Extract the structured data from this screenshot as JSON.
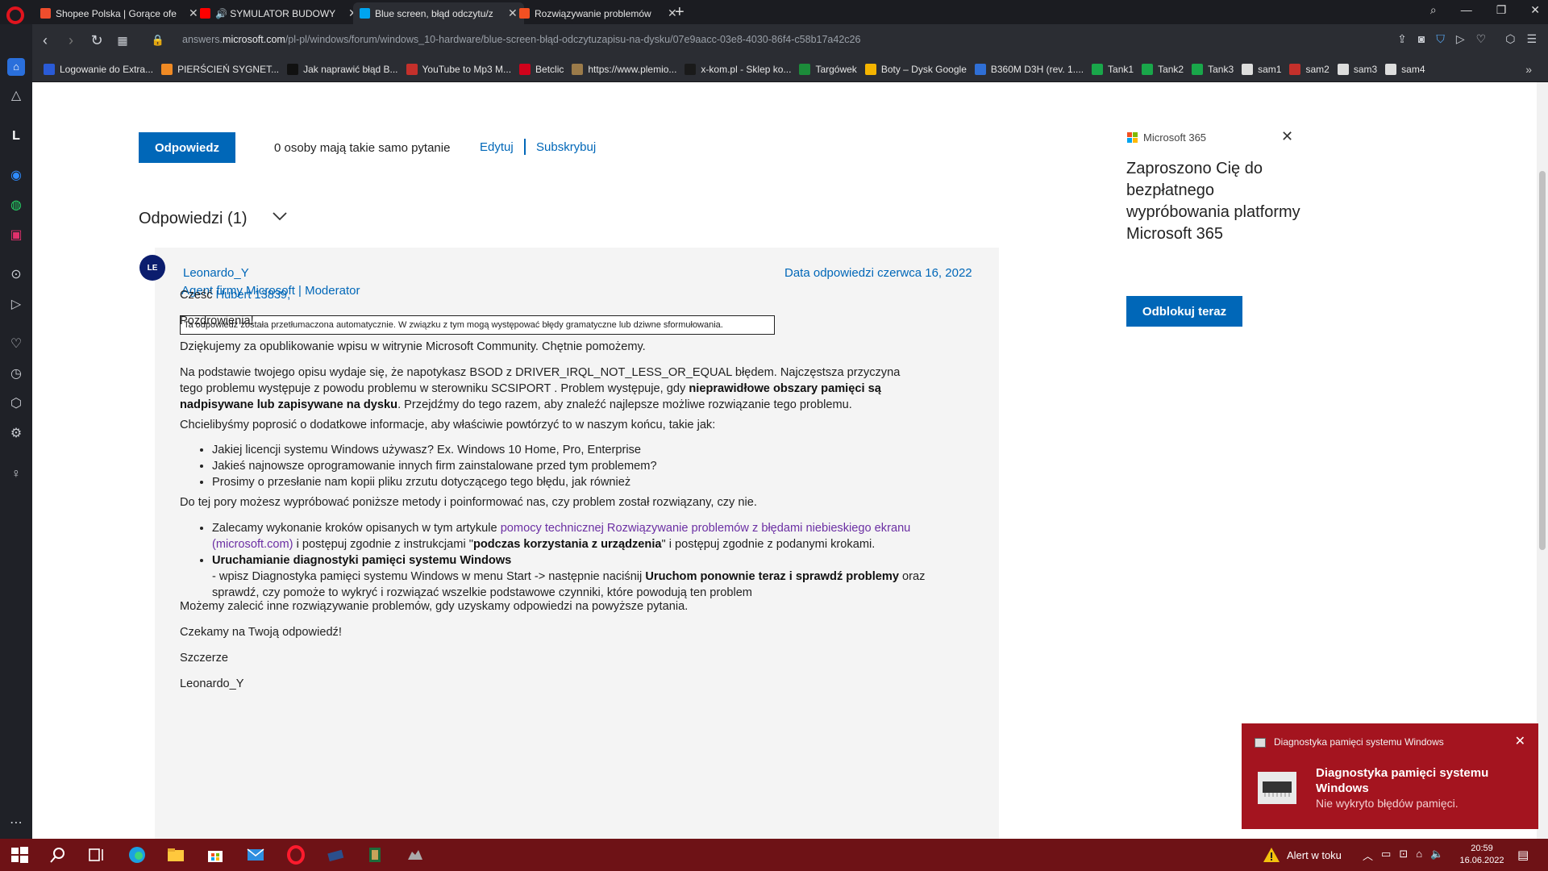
{
  "browser": {
    "tabs": [
      {
        "title": "Shopee Polska | Gorące ofe",
        "color": "#ee4d2d"
      },
      {
        "title": "🔊 SYMULATOR BUDOWY",
        "color": "#ff0000"
      },
      {
        "title": "Blue screen, błąd odczytu/z",
        "color": "#00a4ef"
      },
      {
        "title": "Rozwiązywanie problemów",
        "color": "#f25022"
      }
    ],
    "url_prefix": "answers.",
    "url_domain": "microsoft.com",
    "url_path": "/pl-pl/windows/forum/windows_10-hardware/blue-screen-błąd-odczytuzapisu-na-dysku/07e9aacc-03e8-4030-86f4-c58b17a42c26",
    "bookmarks": [
      {
        "label": "Logowanie do Extra...",
        "color": "#2a5bd7"
      },
      {
        "label": "PIERŚCIEŃ SYGNET...",
        "color": "#f08a24"
      },
      {
        "label": "Jak naprawić błąd B...",
        "color": "#111111"
      },
      {
        "label": "YouTube to Mp3 M...",
        "color": "#c4302b"
      },
      {
        "label": "Betclic",
        "color": "#d0021b"
      },
      {
        "label": "https://www.plemio...",
        "color": "#9b7b4a"
      },
      {
        "label": "x-kom.pl - Sklep ko...",
        "color": "#1a1a1a"
      },
      {
        "label": "Targówek",
        "color": "#1c8c3a"
      },
      {
        "label": "Boty – Dysk Google",
        "color": "#f4b400"
      },
      {
        "label": "B360M D3H (rev. 1....",
        "color": "#2f6fd6"
      },
      {
        "label": "Tank1",
        "color": "#19a74a"
      },
      {
        "label": "Tank2",
        "color": "#19a74a"
      },
      {
        "label": "Tank3",
        "color": "#19a74a"
      },
      {
        "label": "sam1",
        "color": "#dddddd"
      },
      {
        "label": "sam2",
        "color": "#c4302b"
      },
      {
        "label": "sam3",
        "color": "#dddddd"
      },
      {
        "label": "sam4",
        "color": "#dddddd"
      }
    ],
    "bookmarks_more": "»"
  },
  "sidebar_icons": [
    "home-icon",
    "flow-icon",
    "extension-l-icon",
    "messenger-icon",
    "whatsapp-icon",
    "instagram-icon",
    "player-icon",
    "send-icon",
    "heart-icon",
    "history-icon",
    "cube-icon",
    "settings-icon",
    "bulb-icon",
    "more-icon"
  ],
  "thread": {
    "reply_button": "Odpowiedz",
    "same_question": "0 osoby mają takie samo pytanie",
    "edit": "Edytuj",
    "subscribe": "Subskrybuj"
  },
  "answers": {
    "title": "Odpowiedzi (1)"
  },
  "answer": {
    "avatar_initials": "LE",
    "author": "Leonardo_Y",
    "role": "Agent firmy Microsoft | Moderator",
    "date": "Data odpowiedzi czerwca 16, 2022",
    "mt_note": "Ta odpowiedź została przetłumaczona automatycznie. W związku z tym mogą występować błędy gramatyczne lub dziwne sformułowania.",
    "greeting_prefix": "Cześć ",
    "greeting_user": "Hubert 13839",
    "greeting_suffix": ",",
    "p_regards": "Pozdrowienia!",
    "p_thanks": "Dziękujemy za opublikowanie wpisu w witrynie Microsoft Community. Chętnie pomożemy.",
    "p_desc_1": "Na podstawie twojego opisu wydaje się, że napotykasz BSOD z DRIVER_IRQL_NOT_LESS_OR_EQUAL błędem. Najczęstsza przyczyna tego problemu występuje z powodu problemu w sterowniku SCSIPORT . Problem występuje, gdy ",
    "p_desc_bold": "nieprawidłowe obszary pamięci są nadpisywane lub zapisywane na dysku",
    "p_desc_2": ". Przejdźmy do tego razem, aby znaleźć najlepsze możliwe rozwiązanie tego problemu.",
    "p_info": "Chcielibyśmy poprosić o dodatkowe informacje, aby właściwie powtórzyć to w naszym końcu, takie jak:",
    "questions": [
      "Jakiej licencji systemu Windows używasz? Ex. Windows 10 Home, Pro, Enterprise",
      "Jakieś najnowsze oprogramowanie innych firm zainstalowane przed tym problemem?",
      "Prosimy o przesłanie nam kopii pliku zrzutu dotyczącego tego błędu, jak również"
    ],
    "p_try": "Do tej pory możesz wypróbować poniższe metody i poinformować nas, czy problem został rozwiązany, czy nie.",
    "step1_a": "Zalecamy wykonanie kroków opisanych w tym artykule ",
    "step1_link": "pomocy technicznej Rozwiązywanie problemów z błędami niebieskiego ekranu (microsoft.com)",
    "step1_b": " i postępuj zgodnie z instrukcjami \"",
    "step1_bold": "podczas korzystania z urządzenia",
    "step1_c": "\" i postępuj zgodnie z podanymi krokami.",
    "step2_title": "Uruchamianie diagnostyki pamięci systemu Windows",
    "step2_a": "- wpisz Diagnostyka pamięci systemu Windows w menu Start -> następnie naciśnij ",
    "step2_bold": "Uruchom ponownie teraz i sprawdź problemy",
    "step2_b": " oraz sprawdź, czy pomoże to wykryć i rozwiązać wszelkie podstawowe czynniki, które powodują ten problem",
    "p_more": "Możemy zalecić inne rozwiązywanie problemów, gdy uzyskamy odpowiedzi na powyższe pytania.",
    "p_wait": "Czekamy na Twoją odpowiedź!",
    "p_sincerely": "Szczerze",
    "p_sign": "Leonardo_Y"
  },
  "ad": {
    "brand": "Microsoft 365",
    "heading": "Zaproszono Cię do bezpłatnego wypróbowania platformy Microsoft 365",
    "button": "Odblokuj teraz",
    "close": "✕"
  },
  "toast": {
    "app": "Diagnostyka pamięci systemu Windows",
    "title": "Diagnostyka pamięci systemu Windows",
    "body": "Nie wykryto błędów pamięci.",
    "close": "✕"
  },
  "taskbar": {
    "alert": "Alert w toku",
    "time": "20:59",
    "date": "16.06.2022"
  }
}
